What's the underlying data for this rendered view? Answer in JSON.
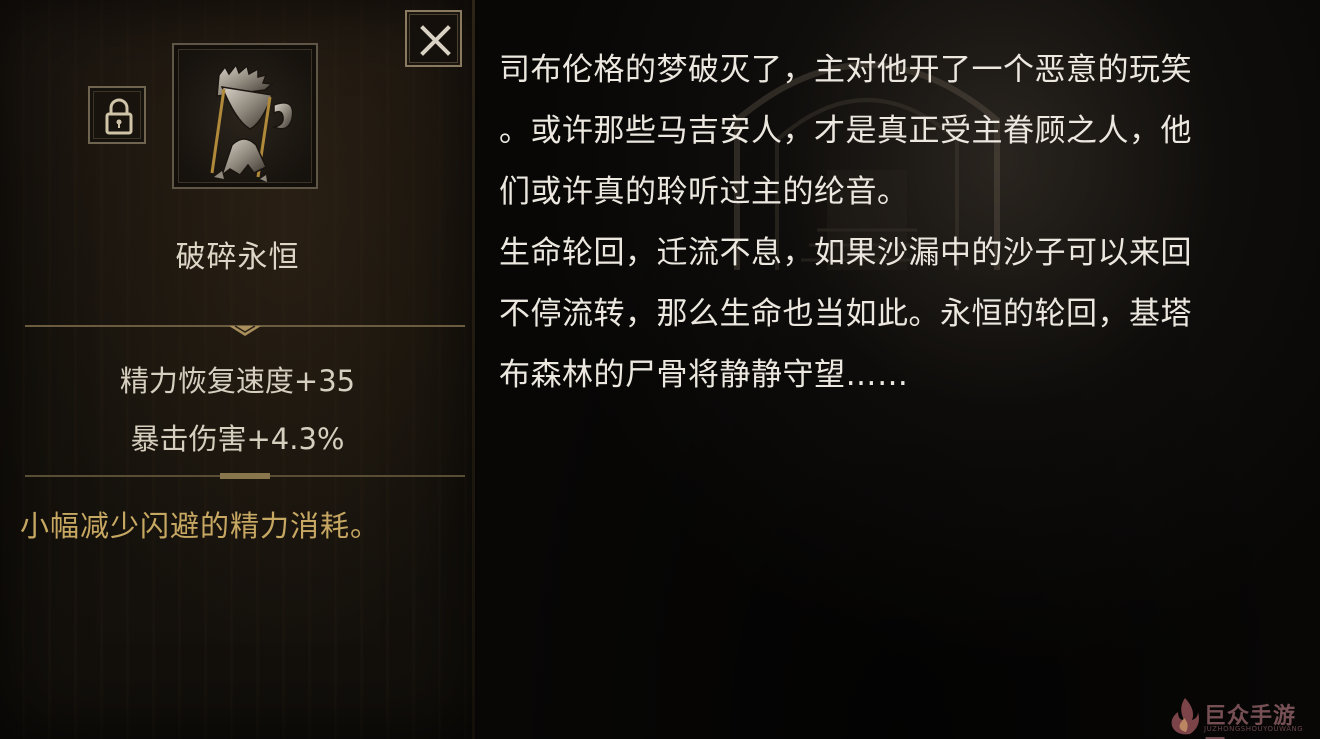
{
  "item": {
    "name": "破碎永恒",
    "locked_icon": "lock-icon",
    "image_icon": "broken-hourglass-icon",
    "stats": [
      "精力恢复速度+35",
      "暴击伤害+4.3%"
    ],
    "effect": "小幅减少闪避的精力消耗。"
  },
  "close_icon": "close-icon",
  "lore": {
    "lines": [
      "司布伦格的梦破灭了，主对他开了一个恶意的玩笑",
      "。或许那些马吉安人，才是真正受主眷顾之人，他",
      "们或许真的聆听过主的纶音。",
      "生命轮回，迁流不息，如果沙漏中的沙子可以来回",
      "不停流转，那么生命也当如此。永恒的轮回，基塔",
      "布森林的尸骨将静静守望……"
    ]
  },
  "watermark": {
    "text": "巨众手游网",
    "sub": "JUZHONGSHOUYOUWANG"
  },
  "colors": {
    "accent_gold": "#c7a863",
    "text_light": "#ece8e0",
    "frame_border": "#8a7a60"
  }
}
